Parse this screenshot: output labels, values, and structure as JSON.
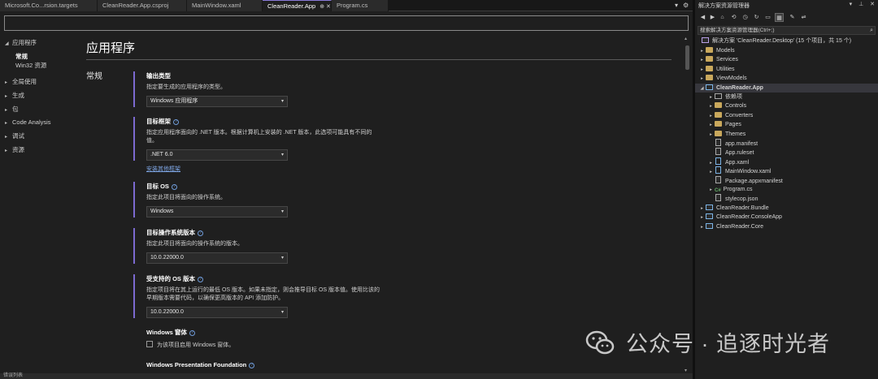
{
  "tabs": [
    {
      "label": "Microsoft.Co...rsion.targets"
    },
    {
      "label": "CleanReader.App.csproj"
    },
    {
      "label": "MainWindow.xaml"
    },
    {
      "label": "CleanReader.App",
      "pin": "⊕ ✕"
    },
    {
      "label": "Program.cs"
    }
  ],
  "tab_controls": {
    "dropdown": "▾",
    "settings": "⚙"
  },
  "nav": {
    "application": "应用程序",
    "application_sub": [
      "常规",
      "Win32 资源"
    ],
    "items": [
      "全局使用",
      "生成",
      "包",
      "Code Analysis",
      "调试",
      "资源"
    ]
  },
  "content": {
    "page_title": "应用程序",
    "section": "常规",
    "output_type": {
      "title": "输出类型",
      "desc": "指定要生成的应用程序的类型。",
      "value": "Windows 应用程序"
    },
    "target_framework": {
      "title": "目标框架",
      "desc1": "指定应用程序面向的 .NET 版本。根据计算机上安装的 .NET 版本，此选项可能具有不同的",
      "desc2": "值。",
      "value": ".NET 6.0",
      "link": "安装其他框架"
    },
    "target_os": {
      "title": "目标 OS",
      "desc": "指定此项目将面向的操作系统。",
      "value": "Windows"
    },
    "target_os_version": {
      "title": "目标操作系统版本",
      "desc": "指定此项目将面向的操作系统的版本。",
      "value": "10.0.22000.0"
    },
    "supported_os_version": {
      "title": "受支持的 OS 版本",
      "desc1": "指定项目将在其上运行的最低 OS 版本。如果未指定，则会推导目标 OS 版本值。使用比该的",
      "desc2": "早期版本需要代码，以确保更高版本的 API 添加防护。",
      "value": "10.0.22000.0"
    },
    "windows_forms": {
      "title": "Windows 窗体",
      "checkbox": "为该项目启用 Windows 窗体。"
    },
    "wpf": {
      "title": "Windows Presentation Foundation"
    }
  },
  "bottom_bar": "错误列表",
  "explorer": {
    "title": "解决方案资源管理器",
    "controls": [
      "▾",
      "⊥",
      "✕"
    ],
    "search_placeholder": "搜索解决方案资源管理器(Ctrl+;)",
    "solution": "解决方案 'CleanReader.Desktop' (15 个项目，共 15 个)",
    "tree": [
      {
        "label": "Models",
        "icon": "folder",
        "level": 1,
        "twisty": "▸"
      },
      {
        "label": "Services",
        "icon": "folder",
        "level": 1,
        "twisty": "▸"
      },
      {
        "label": "Utilities",
        "icon": "folder",
        "level": 1,
        "twisty": "▸"
      },
      {
        "label": "ViewModels",
        "icon": "folder",
        "level": 1,
        "twisty": "▸"
      },
      {
        "label": "CleanReader.App",
        "icon": "proj",
        "level": 1,
        "twisty": "◢",
        "selected": true
      },
      {
        "label": "依赖项",
        "icon": "deps",
        "level": 2,
        "twisty": "▸"
      },
      {
        "label": "Controls",
        "icon": "folder",
        "level": 2,
        "twisty": "▸"
      },
      {
        "label": "Converters",
        "icon": "folder",
        "level": 2,
        "twisty": "▸"
      },
      {
        "label": "Pages",
        "icon": "folder",
        "level": 2,
        "twisty": "▸"
      },
      {
        "label": "Themes",
        "icon": "folder",
        "level": 2,
        "twisty": "▸"
      },
      {
        "label": "app.manifest",
        "icon": "file",
        "level": 2,
        "twisty": ""
      },
      {
        "label": "App.ruleset",
        "icon": "file",
        "level": 2,
        "twisty": ""
      },
      {
        "label": "App.xaml",
        "icon": "xaml",
        "level": 2,
        "twisty": "▸"
      },
      {
        "label": "MainWindow.xaml",
        "icon": "xaml",
        "level": 2,
        "twisty": "▸"
      },
      {
        "label": "Package.appxmanifest",
        "icon": "file",
        "level": 2,
        "twisty": ""
      },
      {
        "label": "Program.cs",
        "icon": "cs",
        "level": 2,
        "twisty": "▸"
      },
      {
        "label": "stylecop.json",
        "icon": "file",
        "level": 2,
        "twisty": ""
      },
      {
        "label": "CleanReader.Bundle",
        "icon": "proj",
        "level": 1,
        "twisty": "▸"
      },
      {
        "label": "CleanReader.ConsoleApp",
        "icon": "proj",
        "level": 1,
        "twisty": "▸"
      },
      {
        "label": "CleanReader.Core",
        "icon": "proj",
        "level": 1,
        "twisty": "▸"
      }
    ]
  },
  "watermark": "公众号 · 追逐时光者",
  "colors": {
    "accent": "#7c6ad0",
    "link": "#7fa7e6",
    "background": "#1f1f1f",
    "folder": "#c9a85c"
  }
}
